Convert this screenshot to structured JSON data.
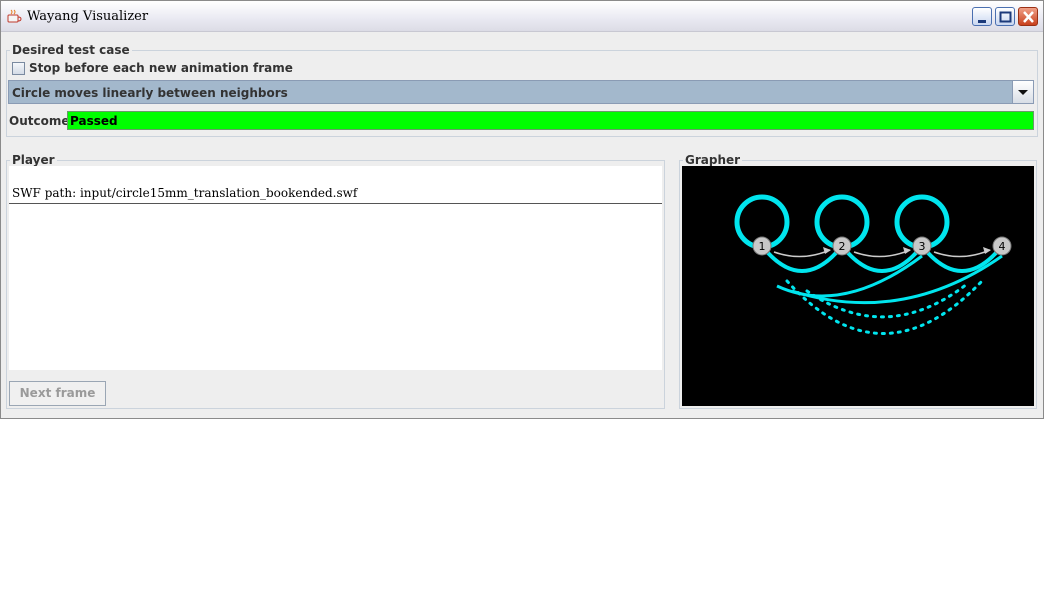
{
  "window": {
    "title": "Wayang Visualizer"
  },
  "title_buttons": {
    "minimize": "minimize-icon",
    "maximize": "maximize-icon",
    "close": "close-icon"
  },
  "desired_test_case": {
    "legend": "Desired test case",
    "stop_checkbox": {
      "label": "Stop before each new animation frame",
      "checked": false
    },
    "test_case_select": {
      "selected": "Circle moves linearly between neighbors"
    },
    "outcome": {
      "label": "Outcome:",
      "value": "Passed",
      "color": "#00ff00"
    }
  },
  "player": {
    "legend": "Player",
    "swf_path": "SWF path: input/circle15mm_translation_bookended.swf",
    "next_frame_label": "Next frame"
  },
  "grapher": {
    "legend": "Grapher",
    "nodes": [
      "1",
      "2",
      "3",
      "4"
    ],
    "edge_color": "#00e5ee",
    "background": "#000000"
  }
}
